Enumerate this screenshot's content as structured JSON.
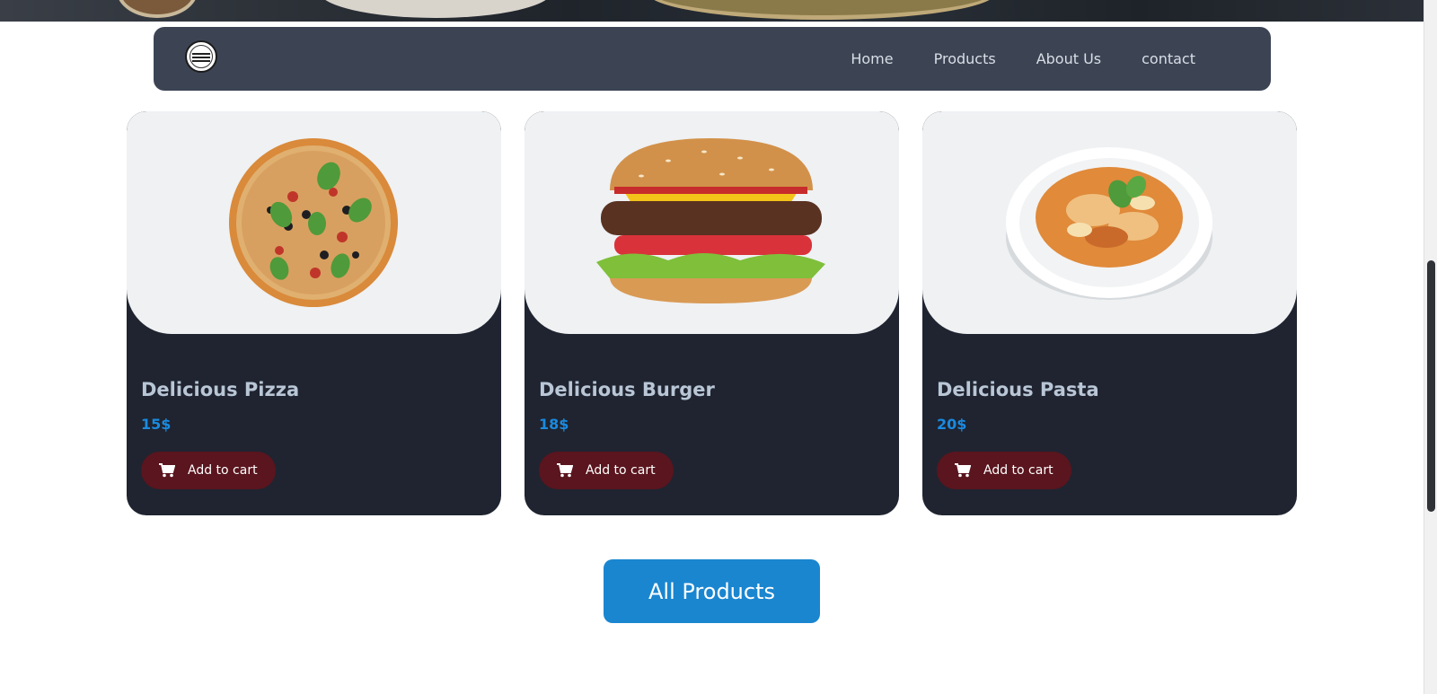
{
  "navbar": {
    "logo_name": "restaurant-logo",
    "links": [
      {
        "label": "Home"
      },
      {
        "label": "Products"
      },
      {
        "label": "About Us"
      },
      {
        "label": "contact"
      }
    ]
  },
  "products": [
    {
      "title": "Delicious Pizza",
      "price": "15$",
      "cart_label": "Add to cart",
      "image": "pizza"
    },
    {
      "title": "Delicious Burger",
      "price": "18$",
      "cart_label": "Add to cart",
      "image": "burger"
    },
    {
      "title": "Delicious Pasta",
      "price": "20$",
      "cart_label": "Add to cart",
      "image": "pasta"
    }
  ],
  "all_products_label": "All Products",
  "colors": {
    "navbar_bg": "#3c4454",
    "card_bg": "#1f2430",
    "card_image_bg": "#eff1f3",
    "price": "#1a8ae0",
    "cart_button": "#5a151e",
    "primary_button": "#1a86d0"
  }
}
